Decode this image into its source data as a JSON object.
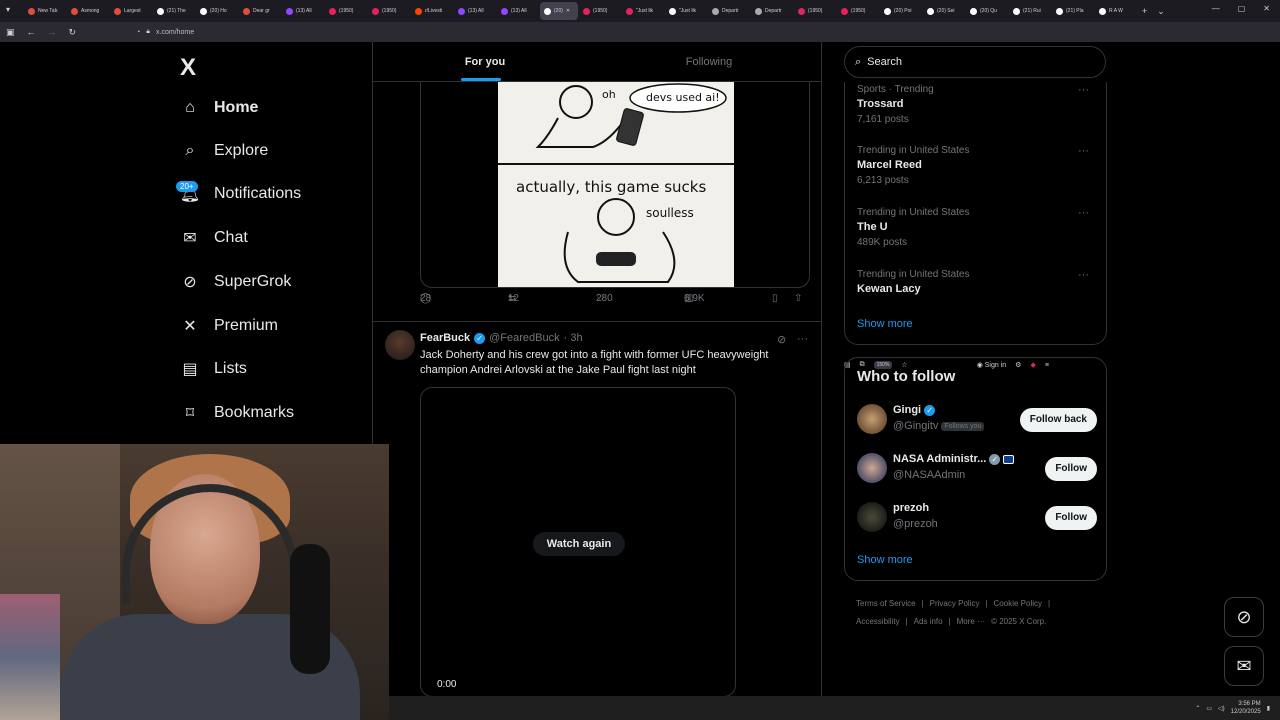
{
  "browser": {
    "tabs": [
      {
        "label": "New Tab",
        "color": "#e04e3a"
      },
      {
        "label": "Asmong",
        "color": "#e04e3a"
      },
      {
        "label": "Largest",
        "color": "#e04e3a"
      },
      {
        "label": "(21) The",
        "color": "#ffffff"
      },
      {
        "label": "(20) Ho",
        "color": "#ffffff"
      },
      {
        "label": "Dear gr",
        "color": "#e04e3a"
      },
      {
        "label": "(13) All",
        "color": "#9146ff"
      },
      {
        "label": "(1950)",
        "color": "#e0245e"
      },
      {
        "label": "(1950)",
        "color": "#e0245e"
      },
      {
        "label": "r/Livesti",
        "color": "#ff4500"
      },
      {
        "label": "(13) All",
        "color": "#9146ff"
      },
      {
        "label": "(13) All",
        "color": "#9146ff"
      },
      {
        "label": "(20)",
        "color": "#ffffff",
        "active": true
      },
      {
        "label": "(1950)",
        "color": "#e0245e"
      },
      {
        "label": "\"Just lik",
        "color": "#e0245e"
      },
      {
        "label": "\"Just lik",
        "color": "#ffffff"
      },
      {
        "label": "Departr",
        "color": "#aaaaaa"
      },
      {
        "label": "Departr",
        "color": "#aaaaaa"
      },
      {
        "label": "(1950)",
        "color": "#e0245e"
      },
      {
        "label": "(1950)",
        "color": "#e0245e"
      },
      {
        "label": "(20) Poi",
        "color": "#ffffff"
      },
      {
        "label": "(20) Sei",
        "color": "#ffffff"
      },
      {
        "label": "(20) Qu",
        "color": "#ffffff"
      },
      {
        "label": "(21) Rui",
        "color": "#ffffff"
      },
      {
        "label": "(21) Pla",
        "color": "#ffffff"
      },
      {
        "label": "R A W",
        "color": "#ffffff"
      }
    ],
    "url": "x.com/home",
    "zoom": "150%",
    "signin": "Sign in"
  },
  "nav": {
    "logo": "X",
    "items": [
      {
        "label": "Home",
        "icon": "home-icon"
      },
      {
        "label": "Explore",
        "icon": "search-icon"
      },
      {
        "label": "Notifications",
        "icon": "bell-icon"
      },
      {
        "label": "Chat",
        "icon": "mail-icon"
      },
      {
        "label": "SuperGrok",
        "icon": "grok-icon"
      },
      {
        "label": "Premium",
        "icon": "x-icon"
      },
      {
        "label": "Lists",
        "icon": "list-icon"
      },
      {
        "label": "Bookmarks",
        "icon": "bookmark-icon"
      }
    ],
    "notif_badge": "20+"
  },
  "feed": {
    "tabs": [
      "For you",
      "Following"
    ],
    "comic": {
      "text_oh": "oh",
      "text_bubble": "devs used ai!",
      "text_caption": "actually, this game sucks",
      "text_soulless": "soulless"
    },
    "actions": {
      "replies": "28",
      "reposts": "12",
      "likes": "280",
      "views": "6.9K"
    },
    "tweet": {
      "name": "FearBuck",
      "handle": "@FearedBuck",
      "time": "· 3h",
      "text": "Jack Doherty and his crew got into a fight with former UFC heavyweight champion Andrei Arlovski at the Jake Paul fight last night",
      "watch_again": "Watch again",
      "video_time": "0:00"
    }
  },
  "sidebar": {
    "search_placeholder": "Search",
    "trends": [
      {
        "context": "Sports · Trending",
        "topic": "Trossard",
        "count": "7,161 posts"
      },
      {
        "context": "Trending in United States",
        "topic": "Marcel Reed",
        "count": "6,213 posts"
      },
      {
        "context": "Trending in United States",
        "topic": "The U",
        "count": "489K posts"
      },
      {
        "context": "Trending in United States",
        "topic": "Kewan Lacy",
        "count": ""
      }
    ],
    "show_more": "Show more",
    "who_to_follow": {
      "title": "Who to follow",
      "accounts": [
        {
          "name": "Gingi",
          "handle": "@Gingitv",
          "follows_you": "Follows you",
          "button": "Follow back"
        },
        {
          "name": "NASA Administr...",
          "handle": "@NASAAdmin",
          "button": "Follow"
        },
        {
          "name": "prezoh",
          "handle": "@prezoh",
          "button": "Follow"
        }
      ],
      "show_more": "Show more"
    },
    "footer": [
      "Terms of Service",
      "|",
      "Privacy Policy",
      "|",
      "Cookie Policy",
      "|",
      "Accessibility",
      "|",
      "Ads info",
      "|",
      "More ···",
      "© 2025 X Corp."
    ]
  },
  "taskbar": {
    "time": "3:56 PM",
    "date": "12/20/2025"
  },
  "colors": {
    "accent": "#1d9bf0",
    "background": "#000000",
    "border": "#2f3336"
  }
}
